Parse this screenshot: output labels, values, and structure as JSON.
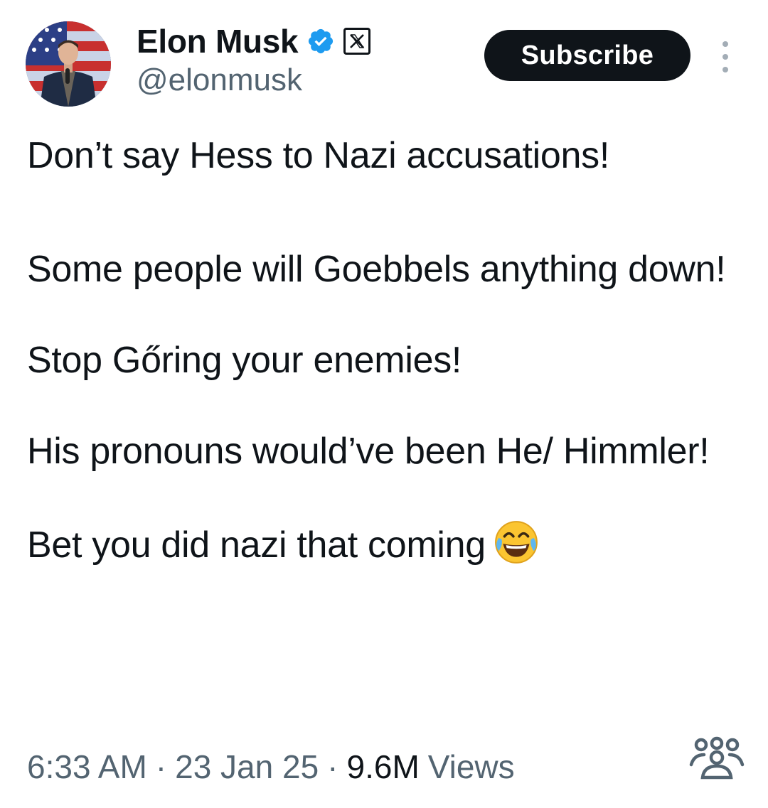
{
  "author": {
    "display_name": "Elon Musk",
    "handle": "@elonmusk",
    "verified_icon": "verified-badge-icon",
    "affiliate_icon": "x-logo-icon"
  },
  "actions": {
    "subscribe_label": "Subscribe",
    "more_icon": "more-vertical-icon"
  },
  "tweet": {
    "paragraphs": [
      "Don’t say Hess to Nazi accusations!",
      "Some people will Goebbels anything down!",
      "Stop Gőring your enemies!",
      "His pronouns would’ve been He/ Himmler!",
      "Bet you did nazi that coming"
    ],
    "trailing_emoji": "face-with-tears-of-joy-icon"
  },
  "meta": {
    "time": "6:33 AM",
    "date": "23 Jan 25",
    "separator": "·",
    "views_count": "9.6M",
    "views_label": "Views",
    "community_icon": "community-icon"
  },
  "colors": {
    "text_primary": "#0f1419",
    "text_secondary": "#536471",
    "verified_blue": "#1d9bf0",
    "button_bg": "#0f1419"
  }
}
